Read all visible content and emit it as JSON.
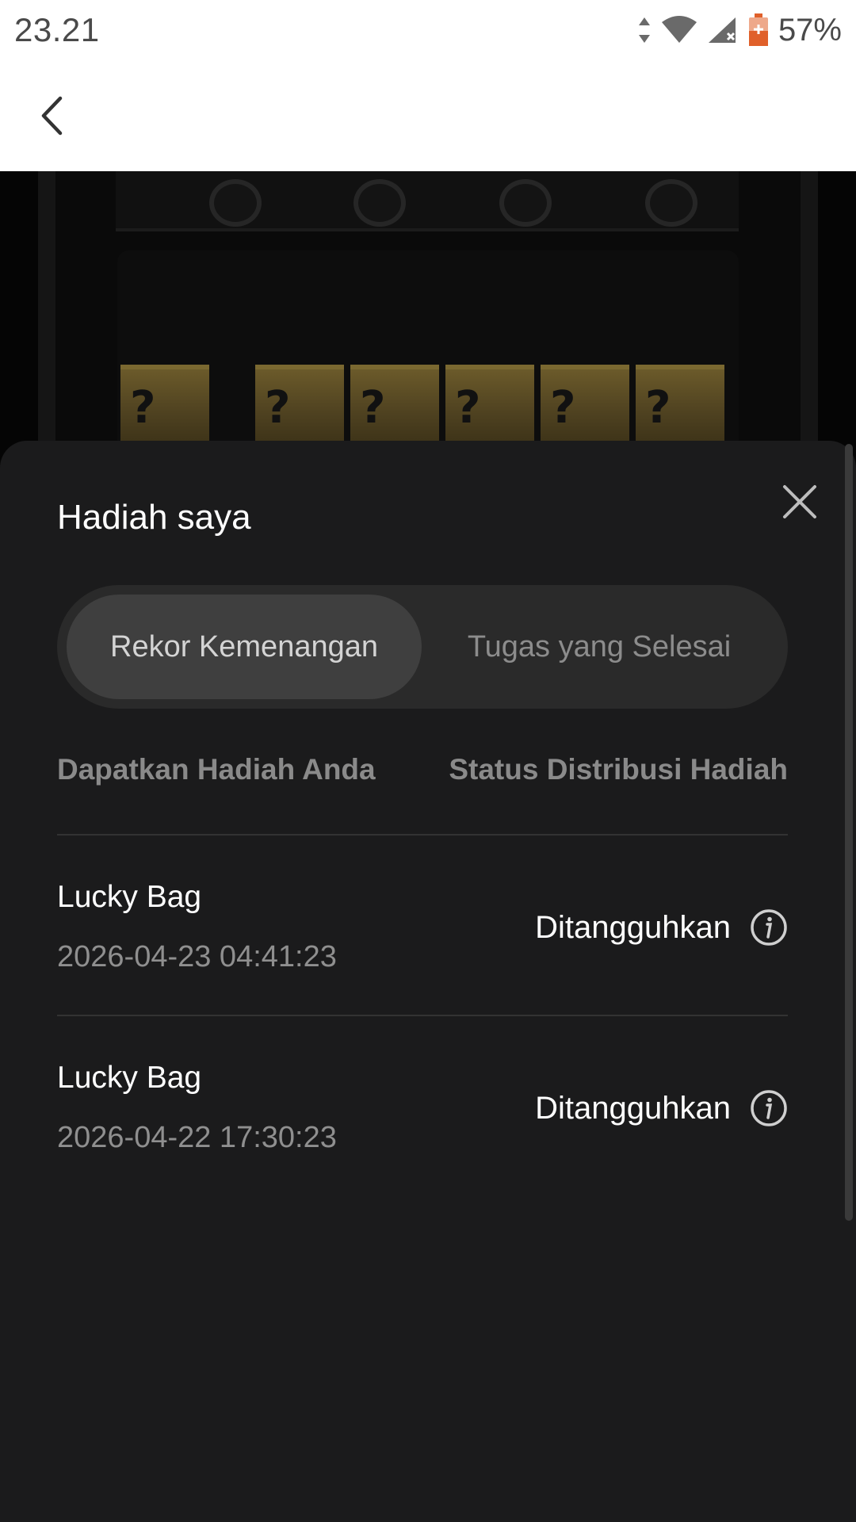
{
  "status_bar": {
    "time": "23.21",
    "battery": "57%",
    "icons": [
      "data-arrows-icon",
      "wifi-icon",
      "signal-icon",
      "battery-icon"
    ]
  },
  "app_bar": {
    "back_icon": "chevron-left-icon"
  },
  "scene": {
    "box_symbol": "?",
    "box_count": 6
  },
  "sheet": {
    "title": "Hadiah saya",
    "close_icon": "close-icon",
    "tabs": [
      {
        "label": "Rekor Kemenangan",
        "active": true
      },
      {
        "label": "Tugas yang Selesai",
        "active": false
      }
    ],
    "columns": {
      "left": "Dapatkan Hadiah Anda",
      "right": "Status Distribusi Hadiah"
    },
    "rows": [
      {
        "name": "Lucky Bag",
        "time": "2026-04-23 04:41:23",
        "status": "Ditangguhkan"
      },
      {
        "name": "Lucky Bag",
        "time": "2026-04-22 17:30:23",
        "status": "Ditangguhkan"
      }
    ]
  },
  "colors": {
    "sheet_bg": "#1b1b1c",
    "tab_track": "#2a2a2a",
    "tab_active": "#3f3f3f",
    "muted_text": "#8a8a8a",
    "battery_accent": "#e0602a"
  }
}
